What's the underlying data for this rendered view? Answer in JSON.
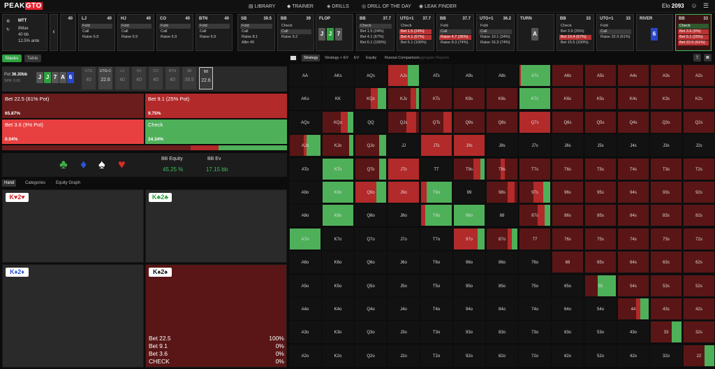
{
  "nav": {
    "logo_main": "PEAK",
    "logo_accent": "GTO",
    "items": [
      "LIBRARY",
      "TRAINER",
      "DRILLS",
      "DRILL OF THE DAY",
      "LEAK FINDER"
    ],
    "elo_label": "Elo",
    "elo_value": "2093"
  },
  "settings": {
    "game": "MTT",
    "format": "8Max",
    "stack": "40 bb",
    "ante": "12.5% ante"
  },
  "positions": [
    {
      "name": "",
      "stack": "40",
      "actions": []
    },
    {
      "name": "LJ",
      "stack": "40",
      "actions": [
        {
          "t": "Fold",
          "s": "sel"
        },
        {
          "t": "Call",
          "s": ""
        },
        {
          "t": "Raise 6.9",
          "s": ""
        }
      ]
    },
    {
      "name": "HJ",
      "stack": "40",
      "actions": [
        {
          "t": "Fold",
          "s": "sel"
        },
        {
          "t": "Call",
          "s": ""
        },
        {
          "t": "Raise 6.9",
          "s": ""
        }
      ]
    },
    {
      "name": "CO",
      "stack": "40",
      "actions": [
        {
          "t": "Fold",
          "s": "sel"
        },
        {
          "t": "Call",
          "s": ""
        },
        {
          "t": "Raise 6.9",
          "s": ""
        }
      ]
    },
    {
      "name": "BTN",
      "stack": "40",
      "actions": [
        {
          "t": "Fold",
          "s": "sel"
        },
        {
          "t": "Call",
          "s": ""
        },
        {
          "t": "Raise 6.9",
          "s": ""
        }
      ]
    },
    {
      "name": "SB",
      "stack": "39.5",
      "actions": [
        {
          "t": "Fold",
          "s": "sel"
        },
        {
          "t": "Call",
          "s": ""
        },
        {
          "t": "Raise 8.1",
          "s": ""
        },
        {
          "t": "Allin 40",
          "s": ""
        }
      ]
    },
    {
      "name": "BB",
      "stack": "39",
      "actions": [
        {
          "t": "Check",
          "s": ""
        },
        {
          "t": "Call",
          "s": "sel"
        },
        {
          "t": "Raise 9.2",
          "s": ""
        }
      ]
    },
    {
      "name": "FLOP",
      "stack": "",
      "actions": []
    },
    {
      "name": "BB",
      "stack": "37.7",
      "actions": [
        {
          "t": "Check",
          "s": "sel"
        },
        {
          "t": "Bet 1.5 (24%)",
          "s": ""
        },
        {
          "t": "Bet 4.1 (67%)",
          "s": ""
        },
        {
          "t": "Bet 6.1 (100%)",
          "s": ""
        }
      ]
    },
    {
      "name": "UTG+1",
      "stack": "37.7",
      "actions": [
        {
          "t": "Check",
          "s": ""
        },
        {
          "t": "Bet 1.5 (24%)",
          "s": "red"
        },
        {
          "t": "Bet 4.1 (67%)",
          "s": "red"
        },
        {
          "t": "Bet 6.1 (100%)",
          "s": ""
        }
      ]
    },
    {
      "name": "BB",
      "stack": "37.7",
      "actions": [
        {
          "t": "Fold",
          "s": ""
        },
        {
          "t": "Call",
          "s": "sel"
        },
        {
          "t": "Raise 4.7 (35%)",
          "s": "red"
        },
        {
          "t": "Raise 8.3 (74%)",
          "s": ""
        }
      ]
    },
    {
      "name": "UTG+1",
      "stack": "36.2",
      "actions": [
        {
          "t": "Fold",
          "s": ""
        },
        {
          "t": "Call",
          "s": "sel"
        },
        {
          "t": "Raise 10.1 (34%)",
          "s": ""
        },
        {
          "t": "Raise 16.3 (74%)",
          "s": ""
        }
      ]
    },
    {
      "name": "TURN",
      "stack": "",
      "actions": []
    },
    {
      "name": "BB",
      "stack": "33",
      "actions": [
        {
          "t": "Check",
          "s": ""
        },
        {
          "t": "Bet 3.9 (25%)",
          "s": ""
        },
        {
          "t": "Bet 10.4 (67%)",
          "s": "red"
        },
        {
          "t": "Bet 15.5 (100%)",
          "s": ""
        }
      ]
    },
    {
      "name": "UTG+1",
      "stack": "33",
      "actions": [
        {
          "t": "Fold",
          "s": ""
        },
        {
          "t": "Call",
          "s": "sel"
        },
        {
          "t": "Raise 32.9 (61%)",
          "s": ""
        }
      ]
    },
    {
      "name": "RIVER",
      "stack": "",
      "actions": []
    },
    {
      "name": "BB",
      "stack": "33",
      "actions": [
        {
          "t": "Check",
          "s": "green"
        },
        {
          "t": "Bet 3.6 (9%)",
          "s": "red"
        },
        {
          "t": "Bet 9.1 (25%)",
          "s": "red"
        },
        {
          "t": "Bet 22.5 (61%)",
          "s": "red"
        }
      ]
    }
  ],
  "board": {
    "flop": [
      "J",
      "J",
      "7"
    ],
    "turn": "A",
    "river": "6"
  },
  "left": {
    "tab_stacks": "Stacks",
    "tab_table": "Table",
    "pot_label": "Pot",
    "pot_value": "36.30bb",
    "spr": "SPR: 0.00",
    "board_cards": [
      "J",
      "J",
      "7",
      "A",
      "6"
    ],
    "stack_cells": [
      {
        "n": "UTG",
        "v": "40"
      },
      {
        "n": "UTG+1",
        "v": "22.6"
      },
      {
        "n": "LJ",
        "v": "40"
      },
      {
        "n": "HJ",
        "v": "40"
      },
      {
        "n": "CO",
        "v": "40"
      },
      {
        "n": "BTN",
        "v": "40"
      },
      {
        "n": "SB",
        "v": "39.5"
      },
      {
        "n": "BB",
        "v": "22.6"
      }
    ],
    "actions": [
      {
        "label": "Bet 22.5 (61% Pot)",
        "pct": "65.87%"
      },
      {
        "label": "Bet 9.1 (25% Pot)",
        "pct": "9.75%"
      },
      {
        "label": "Bet 3.6 (9% Pot)",
        "pct": "0.04%"
      },
      {
        "label": "Check",
        "pct": "24.34%"
      }
    ],
    "equity_label": "BB Equity",
    "equity_value": "45.25 %",
    "ev_label": "BB Ev",
    "ev_value": "17.15 bb",
    "hand_tabs": [
      "Hand",
      "Categories",
      "Equity Graph"
    ],
    "hands": [
      "K♥2♥",
      "K♣2♣",
      "K♦2♦",
      "K♠2♠"
    ],
    "detail": [
      {
        "a": "Bet 22.5",
        "v": "100%"
      },
      {
        "a": "Bet 9.1",
        "v": "0%"
      },
      {
        "a": "Bet 3.6",
        "v": "0%"
      },
      {
        "a": "CHECK",
        "v": "0%"
      }
    ]
  },
  "right": {
    "tabs": [
      "Strategy",
      "Strategy + EV",
      "EV",
      "Equity",
      "Runout Comparison",
      "Aggregate Reports"
    ]
  },
  "colors": {
    "dark_red": "#5a1616",
    "red": "#b22a2a",
    "bright_red": "#e84040",
    "green": "#4fb05a",
    "cell": "#121212"
  }
}
